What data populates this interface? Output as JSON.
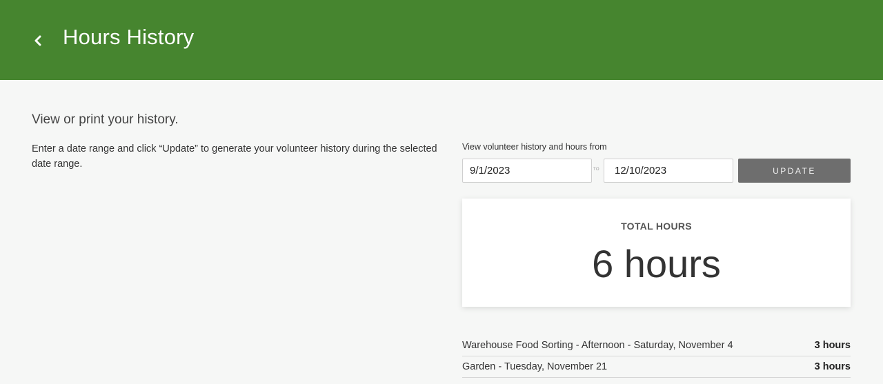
{
  "header": {
    "title": "Hours History",
    "back_icon": "chevron-left-icon",
    "background": "#46852f"
  },
  "intro": {
    "subtitle": "View or print your history.",
    "instructions": "Enter a date range and click “Update” to generate your volunteer history during the selected date range."
  },
  "filter": {
    "label": "View volunteer history and hours from",
    "from_value": "9/1/2023",
    "to_label": "TO",
    "to_value": "12/10/2023",
    "update_label": "UPDATE"
  },
  "total": {
    "label": "TOTAL HOURS",
    "value": "6 hours"
  },
  "history": [
    {
      "activity": "Warehouse Food Sorting - Afternoon - Saturday, November 4",
      "hours": "3 hours"
    },
    {
      "activity": "Garden - Tuesday, November 21",
      "hours": "3 hours"
    }
  ]
}
